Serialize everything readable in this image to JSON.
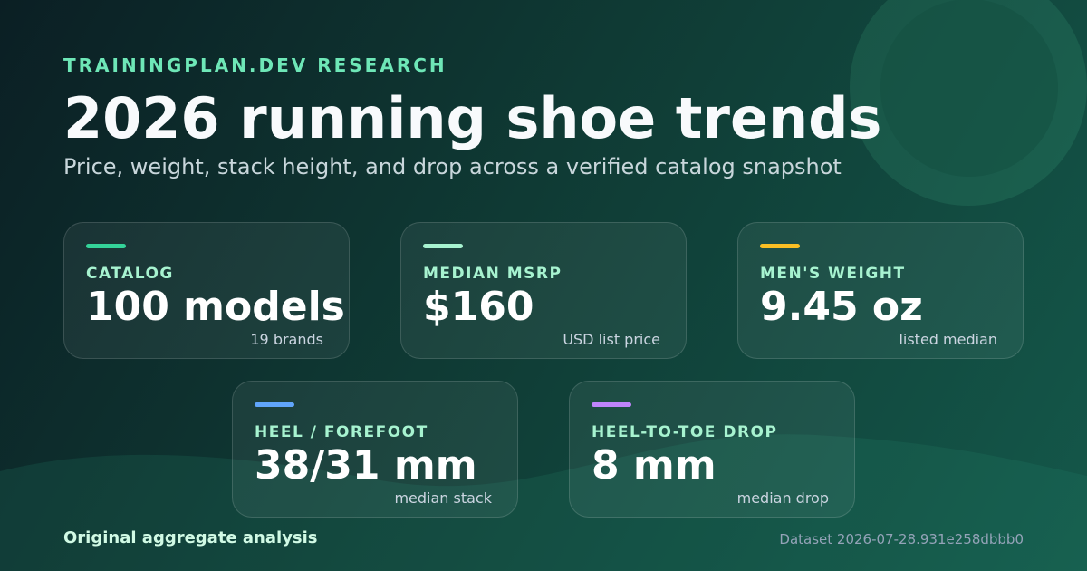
{
  "header": {
    "kicker": "TRAININGPLAN.DEV RESEARCH",
    "title": "2026 running shoe trends",
    "subtitle": "Price, weight, stack height, and drop across a verified catalog snapshot"
  },
  "stats": [
    {
      "label": "CATALOG",
      "value": "100 models",
      "note": "19 brands",
      "accent": "#34d399"
    },
    {
      "label": "MEDIAN MSRP",
      "value": "$160",
      "note": "USD list price",
      "accent": "#a7f3d0"
    },
    {
      "label": "MEN'S WEIGHT",
      "value": "9.45 oz",
      "note": "listed median",
      "accent": "#fbbf24"
    },
    {
      "label": "HEEL / FOREFOOT",
      "value": "38/31 mm",
      "note": "median stack",
      "accent": "#60a5fa"
    },
    {
      "label": "HEEL-TO-TOE DROP",
      "value": "8 mm",
      "note": "median drop",
      "accent": "#c084fc"
    }
  ],
  "footer": {
    "left": "Original aggregate analysis",
    "right": "Dataset 2026-07-28.931e258dbbb0"
  }
}
